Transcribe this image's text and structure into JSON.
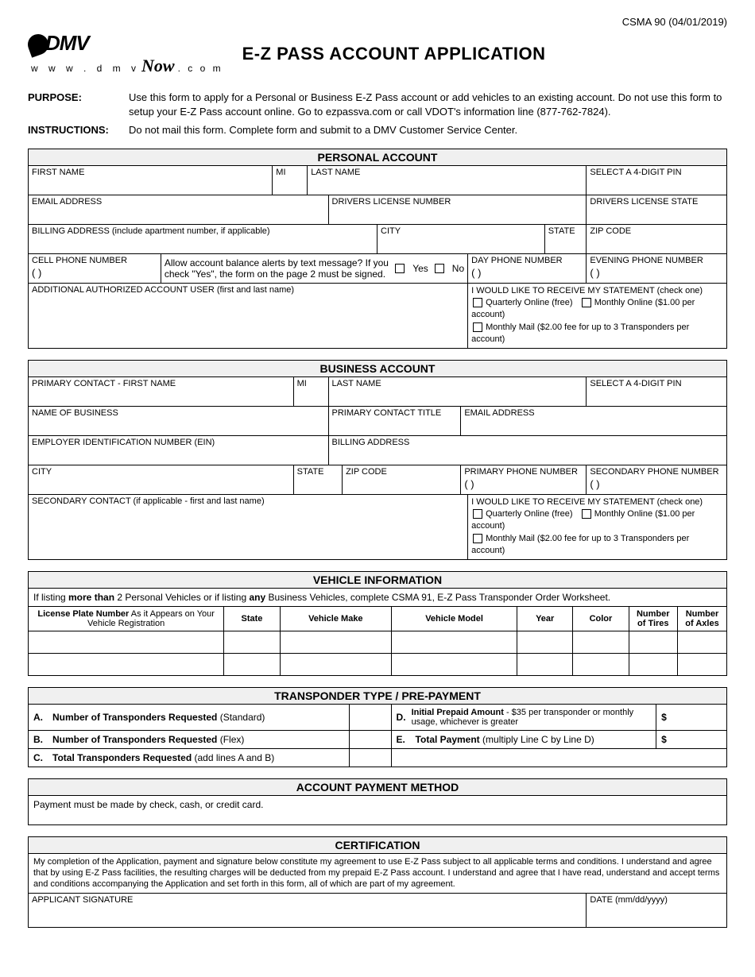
{
  "form_id": "CSMA 90 (04/01/2019)",
  "logo": {
    "brand": "DMV",
    "url_line": "w w w . d m v",
    "now": "Now",
    "dotcom": ". c o m"
  },
  "title": "E-Z PASS ACCOUNT APPLICATION",
  "purpose": {
    "label": "PURPOSE:",
    "text": "Use this form to apply for a Personal or Business E-Z Pass account or add vehicles to an existing account. Do not use this form to setup your E-Z Pass account online. Go to ezpassva.com or call VDOT's information line (877-762-7824)."
  },
  "instructions": {
    "label": "INSTRUCTIONS:",
    "text": "Do not mail this form. Complete form and submit to a DMV Customer Service Center."
  },
  "personal": {
    "heading": "PERSONAL ACCOUNT",
    "first_name": "FIRST NAME",
    "mi": "MI",
    "last_name": "LAST NAME",
    "pin": "SELECT A 4-DIGIT PIN",
    "email": "EMAIL ADDRESS",
    "dl_num": "DRIVERS LICENSE NUMBER",
    "dl_state": "DRIVERS LICENSE STATE",
    "billing": "BILLING ADDRESS (include apartment number, if applicable)",
    "city": "CITY",
    "state": "STATE",
    "zip": "ZIP CODE",
    "cell": "CELL PHONE NUMBER",
    "alerts_q": "Allow account balance alerts by text message? If you check \"Yes\", the form on the page 2 must be signed.",
    "yes": "Yes",
    "no": "No",
    "day_phone": "DAY PHONE NUMBER",
    "eve_phone": "EVENING PHONE NUMBER",
    "auth_user": "ADDITIONAL AUTHORIZED ACCOUNT USER (first and last name)",
    "stmt_head": "I WOULD LIKE TO RECEIVE MY STATEMENT (check one)",
    "stmt_q": "Quarterly Online (free)",
    "stmt_m": "Monthly Online ($1.00 per account)",
    "stmt_mail": "Monthly Mail ($2.00 fee for up to 3 Transponders per account)"
  },
  "business": {
    "heading": "BUSINESS ACCOUNT",
    "pc_first": "PRIMARY CONTACT - FIRST NAME",
    "mi": "MI",
    "last_name": "LAST NAME",
    "pin": "SELECT A 4-DIGIT PIN",
    "biz_name": "NAME OF BUSINESS",
    "pc_title": "PRIMARY CONTACT TITLE",
    "email": "EMAIL ADDRESS",
    "ein": "EMPLOYER IDENTIFICATION NUMBER (EIN)",
    "billing": "BILLING ADDRESS",
    "city": "CITY",
    "state": "STATE",
    "zip": "ZIP CODE",
    "p_phone": "PRIMARY PHONE NUMBER",
    "s_phone": "SECONDARY PHONE NUMBER",
    "sec_contact": "SECONDARY CONTACT (if applicable - first and last name)",
    "stmt_head": "I WOULD LIKE TO RECEIVE MY STATEMENT (check one)",
    "stmt_q": "Quarterly Online (free)",
    "stmt_m": "Monthly Online ($1.00 per account)",
    "stmt_mail": "Monthly Mail ($2.00 fee for up to 3 Transponders per account)"
  },
  "vehicle": {
    "heading": "VEHICLE INFORMATION",
    "note_pre": "If listing ",
    "note_b1": "more than",
    "note_mid": " 2 Personal Vehicles or if listing ",
    "note_b2": "any",
    "note_post": " Business Vehicles, complete CSMA 91, E-Z Pass Transponder Order Worksheet.",
    "cols": {
      "plate_l1": "License Plate Number",
      "plate_l2": " As it Appears on Your Vehicle Registration",
      "state": "State",
      "make": "Vehicle Make",
      "model": "Vehicle Model",
      "year": "Year",
      "color": "Color",
      "tires": "Number of Tires",
      "axles": "Number of Axles"
    }
  },
  "transponder": {
    "heading": "TRANSPONDER TYPE / PRE-PAYMENT",
    "a_l": "A.",
    "a_t_b": "Number of Transponders Requested",
    "a_t_r": " (Standard)",
    "b_l": "B.",
    "b_t_b": "Number of Transponders Requested",
    "b_t_r": " (Flex)",
    "c_l": "C.",
    "c_t_b": "Total Transponders Requested",
    "c_t_r": " (add lines A and B)",
    "d_l": "D.",
    "d_t_b": "Initial Prepaid Amount ",
    "d_t_r": " - $35 per transponder or monthly usage, whichever is greater",
    "e_l": "E.",
    "e_t_b": "Total Payment",
    "e_t_r": " (multiply Line C by Line D)",
    "dollar": "$"
  },
  "payment": {
    "heading": "ACCOUNT PAYMENT METHOD",
    "text": "Payment must be made by check, cash, or credit card."
  },
  "cert": {
    "heading": "CERTIFICATION",
    "text": "My completion of the Application, payment and signature below constitute my agreement to use E-Z Pass subject to all applicable terms and conditions. I understand and agree that by using E-Z Pass facilities, the resulting charges will be deducted from my prepaid E-Z Pass account. I understand and agree that I have read, understand and accept terms and conditions accompanying the Application and set forth in this form, all of which are part of my agreement.",
    "sig": "APPLICANT SIGNATURE",
    "date": "DATE (mm/dd/yyyy)"
  },
  "paren": "(            )"
}
